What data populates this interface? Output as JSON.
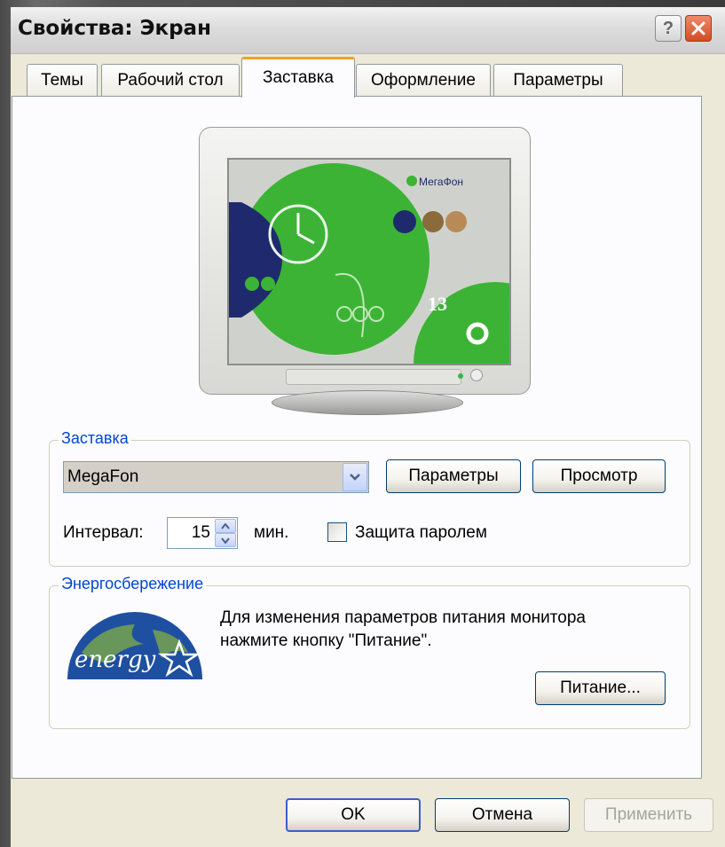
{
  "window": {
    "title": "Свойства: Экран",
    "help_label": "?",
    "close_label": "✕"
  },
  "tabs": [
    {
      "label": "Темы",
      "active": false
    },
    {
      "label": "Рабочий стол",
      "active": false
    },
    {
      "label": "Заставка",
      "active": true
    },
    {
      "label": "Оформление",
      "active": false
    },
    {
      "label": "Параметры",
      "active": false
    }
  ],
  "preview": {
    "brand": "МегаФон",
    "date_number": "13"
  },
  "screensaver": {
    "group_label": "Заставка",
    "selected": "MegaFon",
    "settings_button": "Параметры",
    "preview_button": "Просмотр",
    "interval_label": "Интервал:",
    "interval_value": "15",
    "interval_unit": "мин.",
    "password_label": "Защита паролем",
    "password_checked": false
  },
  "power": {
    "group_label": "Энергосбережение",
    "description_line1": "Для изменения параметров питания монитора",
    "description_line2": "нажмите кнопку \"Питание\".",
    "power_button": "Питание...",
    "logo_text": "energy"
  },
  "footer": {
    "ok": "OK",
    "cancel": "Отмена",
    "apply": "Применить",
    "apply_enabled": false
  },
  "colors": {
    "group_label": "#0046d5",
    "tab_active_accent": "#f0a028",
    "megafon_green": "#3cb335",
    "megafon_navy": "#1f2a6e"
  }
}
